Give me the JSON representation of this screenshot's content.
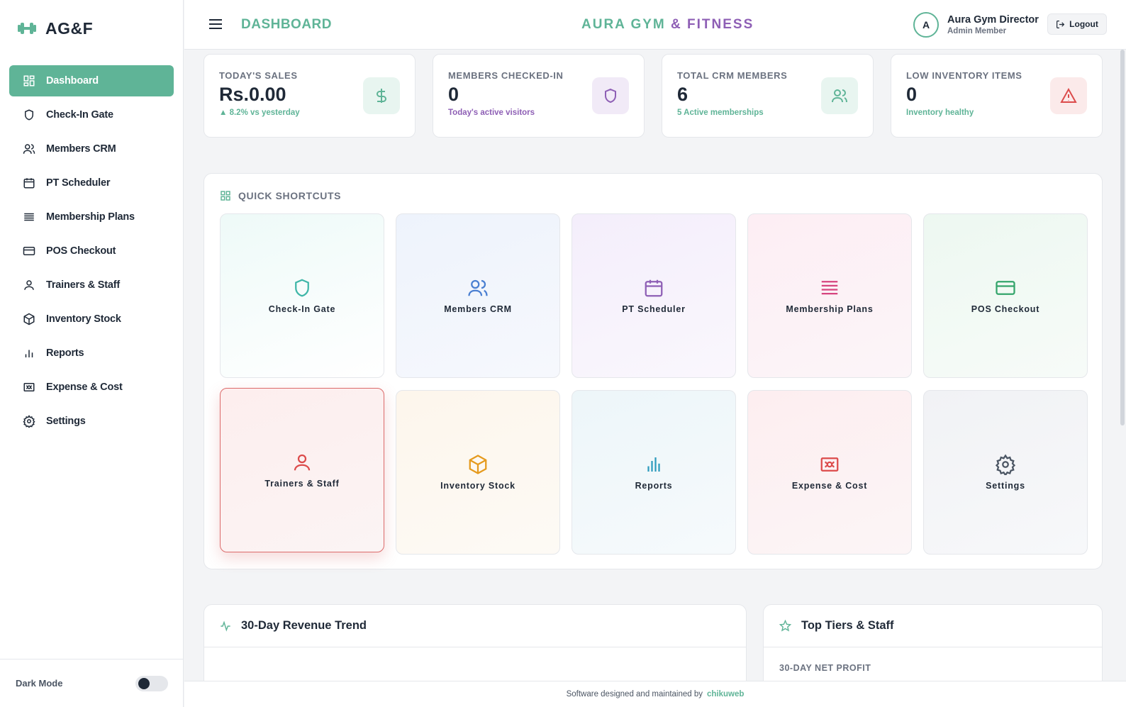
{
  "brand": {
    "name": "AG&F",
    "icon": "dumbbell-icon",
    "color": "#5fb497"
  },
  "sidebar": {
    "items": [
      {
        "label": "Dashboard",
        "icon": "grid-icon",
        "active": true
      },
      {
        "label": "Check-In Gate",
        "icon": "shield-icon"
      },
      {
        "label": "Members CRM",
        "icon": "users-icon"
      },
      {
        "label": "PT Scheduler",
        "icon": "calendar-icon"
      },
      {
        "label": "Membership Plans",
        "icon": "list-icon"
      },
      {
        "label": "POS Checkout",
        "icon": "credit-card-icon"
      },
      {
        "label": "Trainers & Staff",
        "icon": "user-icon"
      },
      {
        "label": "Inventory Stock",
        "icon": "box-icon"
      },
      {
        "label": "Reports",
        "icon": "bar-chart-icon"
      },
      {
        "label": "Expense & Cost",
        "icon": "banknote-icon"
      },
      {
        "label": "Settings",
        "icon": "gear-icon"
      }
    ],
    "dark_mode_label": "Dark Mode",
    "dark_mode_on": false
  },
  "header": {
    "page_title": "DASHBOARD",
    "app_title_1": "AURA GYM",
    "app_title_amp": "&",
    "app_title_2": "FITNESS",
    "user_initial": "A",
    "user_name": "Aura Gym Director",
    "user_role": "Admin Member",
    "logout_label": "Logout"
  },
  "stats": [
    {
      "label": "TODAY'S SALES",
      "value": "Rs.0.00",
      "sub": "▲ 8.2% vs yesterday",
      "icon": "dollar-icon",
      "color": "#5fb497",
      "bg": "#e8f5f0"
    },
    {
      "label": "MEMBERS CHECKED-IN",
      "value": "0",
      "sub": "Today's active visitors",
      "icon": "shield-icon",
      "color": "#8e5fb5",
      "bg": "#f1eaf7"
    },
    {
      "label": "TOTAL CRM MEMBERS",
      "value": "6",
      "sub": "5 Active memberships",
      "icon": "users-icon",
      "color": "#5fb497",
      "bg": "#e8f5f0"
    },
    {
      "label": "LOW INVENTORY ITEMS",
      "value": "0",
      "sub": "Inventory healthy",
      "icon": "alert-triangle-icon",
      "color": "#dc4b4b",
      "bg": "#fbeaea"
    }
  ],
  "shortcuts": {
    "title": "QUICK SHORTCUTS",
    "items": [
      {
        "label": "Check-In Gate",
        "icon": "shield-icon",
        "color": "#3fb6a8"
      },
      {
        "label": "Members CRM",
        "icon": "users-icon",
        "color": "#4a7fd1"
      },
      {
        "label": "PT Scheduler",
        "icon": "calendar-icon",
        "color": "#8e5fb5"
      },
      {
        "label": "Membership Plans",
        "icon": "list-icon",
        "color": "#d6457f"
      },
      {
        "label": "POS Checkout",
        "icon": "credit-card-icon",
        "color": "#34a56b"
      },
      {
        "label": "Trainers & Staff",
        "icon": "user-icon",
        "color": "#dc4b4b",
        "selected": true
      },
      {
        "label": "Inventory Stock",
        "icon": "box-icon",
        "color": "#e59a1c"
      },
      {
        "label": "Reports",
        "icon": "bar-chart-icon",
        "color": "#2f9bbd"
      },
      {
        "label": "Expense & Cost",
        "icon": "banknote-icon",
        "color": "#dc4b4b"
      },
      {
        "label": "Settings",
        "icon": "gear-icon",
        "color": "#4b5563"
      }
    ]
  },
  "revenue_card": {
    "title": "30-Day Revenue Trend",
    "icon": "activity-icon"
  },
  "tiers_card": {
    "title": "Top Tiers & Staff",
    "icon": "star-icon",
    "subtitle": "30-DAY NET PROFIT"
  },
  "footer": {
    "text": "Software designed and maintained by",
    "vendor": "chikuweb"
  }
}
